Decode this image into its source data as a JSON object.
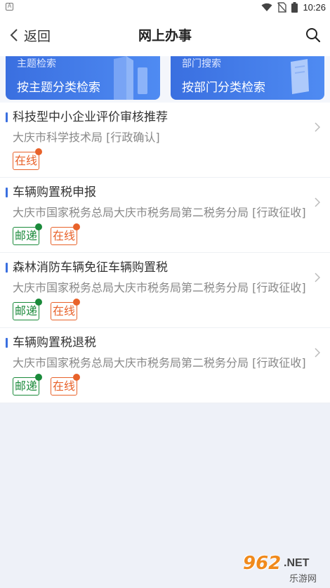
{
  "statusbar": {
    "app_icon_letter": "A",
    "time": "10:26",
    "icons": [
      "wifi-icon",
      "no-sim-icon",
      "battery-icon"
    ]
  },
  "navbar": {
    "back_label": "返回",
    "title": "网上办事",
    "search_icon": "search-icon"
  },
  "cards": [
    {
      "sub": "主题检索",
      "main": "按主题分类检索",
      "art": "building-icon"
    },
    {
      "sub": "部门搜索",
      "main": "按部门分类检索",
      "art": "book-icon"
    }
  ],
  "items": [
    {
      "title": "科技型中小企业评价审核推荐",
      "dept": "大庆市科学技术局  [行政确认]",
      "tags": [
        "在线"
      ]
    },
    {
      "title": "车辆购置税申报",
      "dept": "大庆市国家税务总局大庆市税务局第二税务分局  [行政征收]",
      "tags": [
        "邮递",
        "在线"
      ]
    },
    {
      "title": "森林消防车辆免征车辆购置税",
      "dept": "大庆市国家税务总局大庆市税务局第二税务分局  [行政征收]",
      "tags": [
        "邮递",
        "在线"
      ]
    },
    {
      "title": "车辆购置税退税",
      "dept": "大庆市国家税务总局大庆市税务局第二税务分局  [行政征收]",
      "tags": [
        "邮递",
        "在线"
      ]
    }
  ],
  "colors": {
    "accent": "#3a6fe0",
    "mail_tag": "#1a8a3a",
    "online_tag": "#e8622a",
    "background": "#eef1f8"
  },
  "watermark": {
    "main": "962",
    "net": ".NET",
    "sub": "乐游网"
  }
}
